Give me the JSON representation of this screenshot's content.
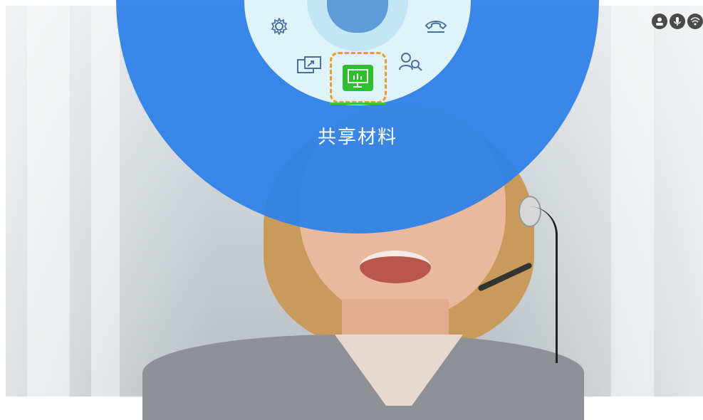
{
  "menu": {
    "active_label": "共享材料",
    "items": [
      {
        "icon": "gear-icon"
      },
      {
        "icon": "hangup-icon"
      },
      {
        "icon": "share-screen-icon"
      },
      {
        "icon": "share-material-icon"
      },
      {
        "icon": "participants-icon"
      }
    ]
  },
  "status_bar": {
    "icons": [
      "user-icon",
      "mic-icon",
      "wifi-icon"
    ]
  },
  "colors": {
    "menu_blue": "#2f82e8",
    "menu_inner": "#dff3fb",
    "highlight_orange": "#f19a2b",
    "active_green": "#3fc33f"
  }
}
